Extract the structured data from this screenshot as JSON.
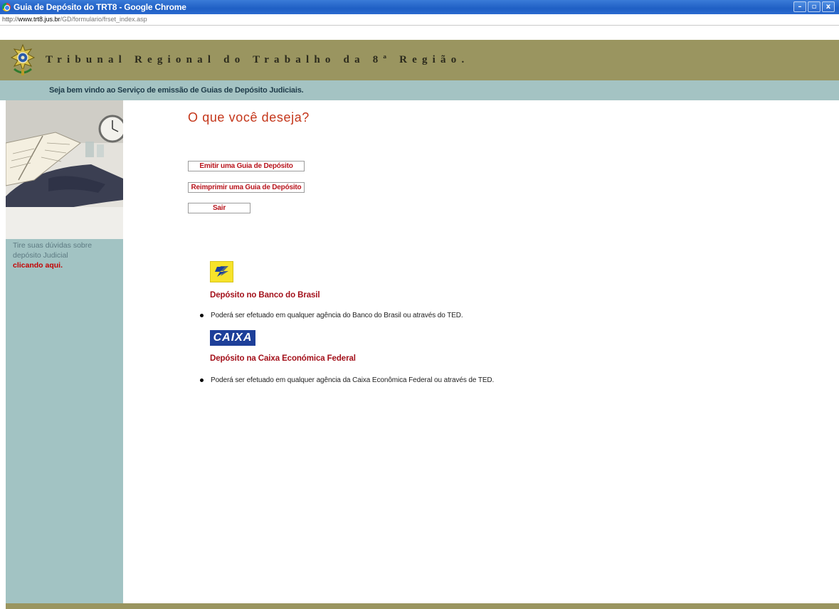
{
  "window": {
    "title": "Guia de Depósito do TRT8 - Google Chrome",
    "controls": [
      "–",
      "▫",
      "x"
    ]
  },
  "address_bar": {
    "scheme": "http://",
    "domain": "www.trt8.jus.br",
    "path": "/GD/formulario/frset_index.asp"
  },
  "header": {
    "title": "Tribunal Regional do Trabalho da 8ª Região.",
    "welcome": "Seja bem vindo ao Serviço de emissão de Guias de Depósito Judiciais."
  },
  "sidebar": {
    "help_line1": "Tire suas dúvidas sobre",
    "help_line2": "depósito Judicial",
    "help_link": "clicando aqui."
  },
  "main": {
    "heading": "O que você deseja?",
    "buttons": {
      "emitir": "Emitir uma Guia de Depósito",
      "reimprimir": "Reimprimir uma Guia de Depósito",
      "sair": "Sair"
    },
    "banks": [
      {
        "logo_text": "",
        "title": "Depósito no Banco do Brasil",
        "desc": "Poderá ser efetuado em qualquer agência do Banco do Brasil ou através do TED."
      },
      {
        "logo_text": "CAIXA",
        "title": "Depósito na Caixa Económica Federal",
        "desc": "Poderá ser efetuado em qualquer agência da Caixa Econômica Federal ou através de TED."
      }
    ]
  },
  "colors": {
    "banner": "#9a9560",
    "welcome_bar": "#a4c3c3",
    "sidebar": "#a2c3c3",
    "heading": "#c4361a",
    "link_red": "#c40000",
    "bank_title": "#a3101a"
  }
}
